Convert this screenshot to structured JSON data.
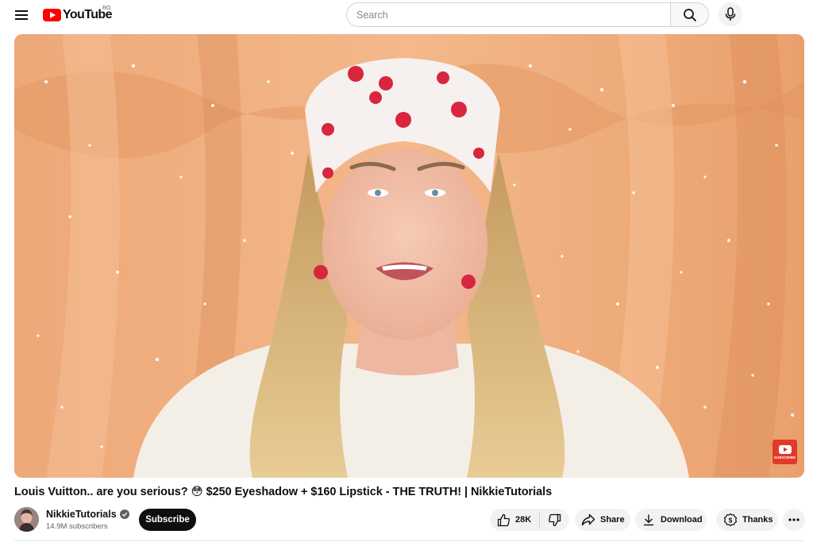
{
  "header": {
    "logo_text": "YouTube",
    "country_code": "RO",
    "search_placeholder": "Search",
    "icons": {
      "menu": "hamburger-menu-icon",
      "search": "magnifier-icon",
      "mic": "microphone-icon"
    }
  },
  "player": {
    "watermark_text": "SUBSCRIBE"
  },
  "video": {
    "title": "Louis Vuitton.. are you serious? 😳 $250 Eyeshadow + $160 Lipstick - THE TRUTH! | NikkieTutorials"
  },
  "owner": {
    "channel_name": "NikkieTutorials",
    "subscribers": "14.9M subscribers",
    "subscribe_label": "Subscribe"
  },
  "actions": {
    "like_count": "28K",
    "share_label": "Share",
    "download_label": "Download",
    "thanks_label": "Thanks"
  },
  "colors": {
    "brand_red": "#ff0000",
    "subscribe_bg": "#0f0f0f",
    "pill_bg": "#f2f2f2"
  }
}
